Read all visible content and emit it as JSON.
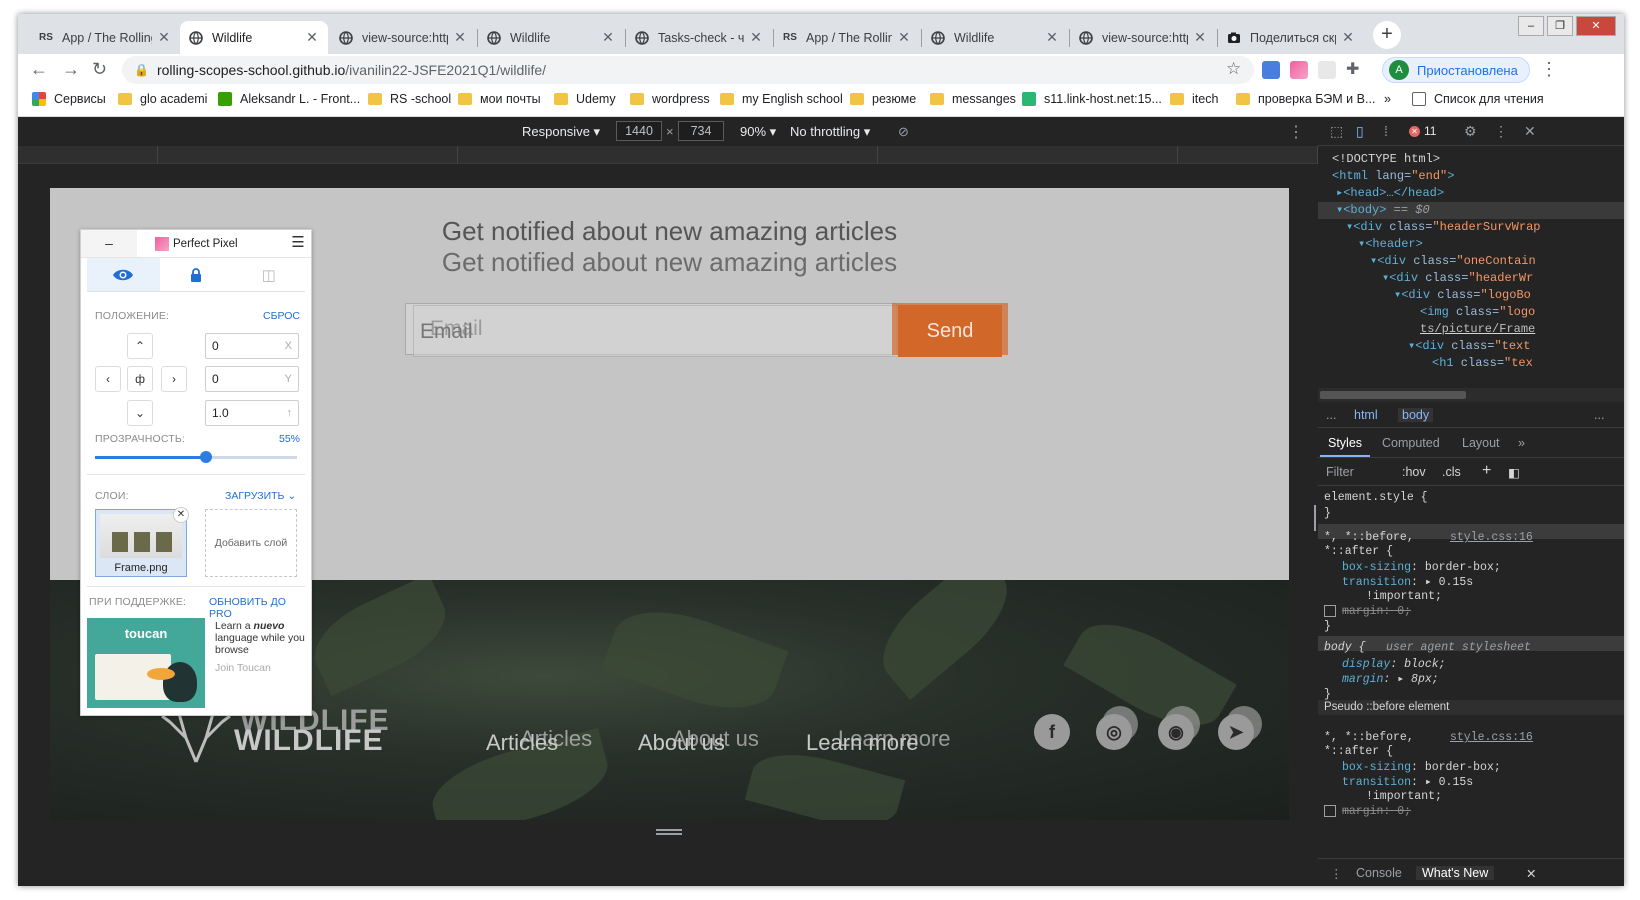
{
  "tabs": [
    {
      "icon": "rs-icon",
      "title": "App / The Rolling",
      "active": false
    },
    {
      "icon": "globe-icon",
      "title": "Wildlife",
      "active": true
    },
    {
      "icon": "globe-icon",
      "title": "view-source:https",
      "active": false
    },
    {
      "icon": "globe-icon",
      "title": "Wildlife",
      "active": false
    },
    {
      "icon": "globe-icon",
      "title": "Tasks-check - че",
      "active": false
    },
    {
      "icon": "rs-icon",
      "title": "App / The Rolling",
      "active": false
    },
    {
      "icon": "globe-icon",
      "title": "Wildlife",
      "active": false
    },
    {
      "icon": "globe-icon",
      "title": "view-source:http",
      "active": false
    },
    {
      "icon": "camera-icon",
      "title": "Поделиться скр",
      "active": false
    }
  ],
  "address": {
    "host": "rolling-scopes-school.github.io",
    "path": "/ivanilin22-JSFE2021Q1/wildlife/"
  },
  "profile": {
    "initial": "A",
    "status": "Приостановлена"
  },
  "bookmarks": [
    {
      "label": "Сервисы",
      "icon": "apps-icon"
    },
    {
      "label": "glo academi",
      "icon": "folder-icon"
    },
    {
      "label": "Aleksandr L. - Front...",
      "icon": "upwork-icon"
    },
    {
      "label": "RS -school",
      "icon": "folder-icon"
    },
    {
      "label": "мои почты",
      "icon": "folder-icon"
    },
    {
      "label": "Udemy",
      "icon": "folder-icon"
    },
    {
      "label": "wordpress",
      "icon": "folder-icon"
    },
    {
      "label": "my English school",
      "icon": "folder-icon"
    },
    {
      "label": "резюме",
      "icon": "folder-icon"
    },
    {
      "label": "messanges",
      "icon": "folder-icon"
    },
    {
      "label": "s11.link-host.net:15...",
      "icon": "site-icon"
    },
    {
      "label": "itech",
      "icon": "folder-icon"
    },
    {
      "label": "проверка БЭМ и В...",
      "icon": "folder-icon"
    },
    {
      "label": "»",
      "icon": ""
    },
    {
      "label": "Список для чтения",
      "icon": "reading-list-icon"
    }
  ],
  "devbar": {
    "mode": "Responsive",
    "width": "1440",
    "height": "734",
    "zoom": "90%",
    "throttle": "No throttling"
  },
  "page": {
    "heading": "Get notified about new amazing articles",
    "email_placeholder": "Email",
    "send_label": "Send",
    "logo": "WILDLIFE",
    "nav": [
      "Articles",
      "About us",
      "Learn more"
    ],
    "social": [
      "f",
      "◎",
      "◉",
      "➤"
    ]
  },
  "perfect_pixel": {
    "minimize": "–",
    "title": "Perfect Pixel",
    "position_label": "ПОЛОЖЕНИЕ:",
    "reset_label": "СБРОС",
    "x_value": "0",
    "y_value": "0",
    "scale_value": "1.0",
    "x_suffix": "X",
    "y_suffix": "Y",
    "scale_suffix": "↑",
    "opacity_label": "ПРОЗРАЧНОСТЬ:",
    "opacity_value": "55%",
    "opacity": 0.55,
    "layers_label": "СЛОИ:",
    "upload_label": "ЗАГРУЗИТЬ",
    "layer_name": "Frame.png",
    "add_layer_label": "Добавить слой",
    "support_label": "ПРИ ПОДДЕРЖКЕ:",
    "upgrade_label": "ОБНОВИТЬ ДО PRO",
    "ad_title": "toucan",
    "ad_text_1": "Learn a",
    "ad_text_em": "nuevo",
    "ad_text_2": "language while you browse",
    "ad_join": "Join Toucan"
  },
  "devtools": {
    "errors": "11",
    "dom": [
      {
        "text": "<!DOCTYPE html>"
      },
      {
        "tag": "<html",
        "attr": " lang=",
        "val": "\"end\"",
        "end": ">"
      },
      {
        "tag": "▸<head>…</head>"
      },
      {
        "tag": "▾<body>",
        "tail": " == $0"
      },
      {
        "tag": "▾<div",
        "attr": " class=",
        "val": "\"headerSurvWrap"
      },
      {
        "tag": "▾<header>"
      },
      {
        "tag": "▾<div",
        "attr": " class=",
        "val": "\"oneContain"
      },
      {
        "tag": "▾<div",
        "attr": " class=",
        "val": "\"headerWr"
      },
      {
        "tag": "▾<div",
        "attr": " class=",
        "val": "\"logoBo"
      },
      {
        "tag": "<img",
        "attr": " class=",
        "val": "\"logo"
      },
      {
        "val": "ts/picture/Frame"
      },
      {
        "tag": "▾<div",
        "attr": " class=",
        "val": "\"text"
      },
      {
        "tag": "<h1",
        "attr": " class=",
        "val": "\"tex"
      }
    ],
    "crumbs": [
      "...",
      "html",
      "body",
      "..."
    ],
    "subtabs": [
      "Styles",
      "Computed",
      "Layout",
      "»"
    ],
    "filter": {
      "placeholder": "Filter",
      "hov": ":hov",
      "cls": ".cls"
    },
    "rules": {
      "element_style": "element.style {",
      "close": "}",
      "universal_selector": "*, *::before,",
      "universal_selector_2": "*::after {",
      "source": "style.css:16",
      "box_sizing_prop": "box-sizing",
      "box_sizing_val": "border-box;",
      "transition_prop": "transition",
      "transition_val": "▸ 0.15s",
      "important": "!important;",
      "margin_prop": "margin: 0;",
      "body_selector": "body {",
      "ua_label": "user agent stylesheet",
      "display_prop": "display",
      "display_val": "block;",
      "margin_ua_prop": "margin",
      "margin_ua_val": "▸ 8px;",
      "pseudo_before": "Pseudo ::before element"
    },
    "drawer": [
      "Console",
      "What's New"
    ]
  }
}
